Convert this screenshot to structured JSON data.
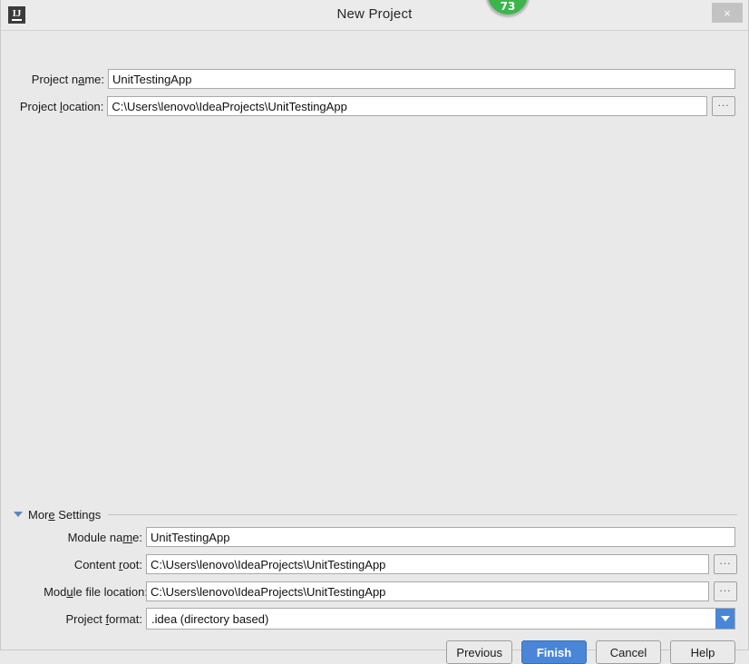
{
  "window": {
    "title": "New Project",
    "app_icon": "intellij-idea-icon",
    "close_label": "×",
    "notification_badge": "73"
  },
  "main_form": {
    "project_name": {
      "label_before": "Project n",
      "label_mnemonic": "a",
      "label_after": "me:",
      "value": "UnitTestingApp"
    },
    "project_location": {
      "label_before": "Project ",
      "label_mnemonic": "l",
      "label_after": "ocation:",
      "value": "C:\\Users\\lenovo\\IdeaProjects\\UnitTestingApp",
      "browse_label": "..."
    }
  },
  "more_settings": {
    "section_label_before": "Mor",
    "section_label_mnemonic": "e",
    "section_label_after": " Settings",
    "expanded": true,
    "module_name": {
      "label_before": "Module na",
      "label_mnemonic": "m",
      "label_after": "e:",
      "value": "UnitTestingApp"
    },
    "content_root": {
      "label_before": "Content ",
      "label_mnemonic": "r",
      "label_after": "oot:",
      "value": "C:\\Users\\lenovo\\IdeaProjects\\UnitTestingApp",
      "browse_label": "..."
    },
    "module_file_location": {
      "label_before": "Mod",
      "label_mnemonic": "u",
      "label_after": "le file location:",
      "value": "C:\\Users\\lenovo\\IdeaProjects\\UnitTestingApp",
      "browse_label": "..."
    },
    "project_format": {
      "label_before": "Project ",
      "label_mnemonic": "f",
      "label_after": "ormat:",
      "value": ".idea (directory based)"
    }
  },
  "buttons": {
    "previous": "Previous",
    "finish": "Finish",
    "cancel": "Cancel",
    "help": "Help"
  },
  "colors": {
    "dialog_bg": "#e9e9e9",
    "accent_blue": "#4a86d8",
    "badge_green": "#3cb54a",
    "field_bg": "#ffffff",
    "field_border": "#a9a9a9"
  }
}
